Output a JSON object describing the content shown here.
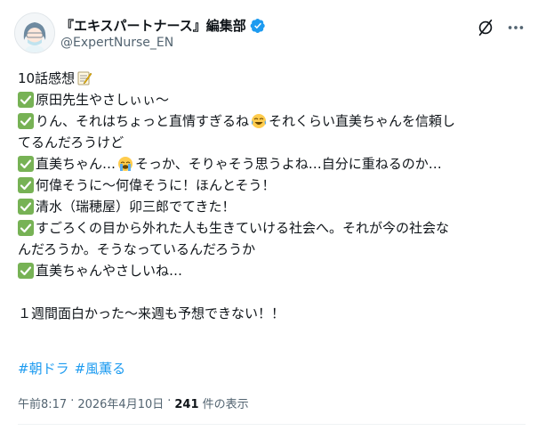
{
  "author": {
    "display_name": "『エキスパートナース』編集部",
    "handle": "@ExpertNurse_EN"
  },
  "tweet": {
    "lines": [
      {
        "text_a": "10話感想",
        "emoji": "memo"
      },
      {
        "check": true,
        "text_a": "原田先生やさしぃぃ～"
      },
      {
        "check": true,
        "text_a": "りん、それはちょっと直情すぎるね",
        "emoji": "joy",
        "text_b": "それくらい直美ちゃんを信頼し"
      },
      {
        "text_a": "てるんだろうけど"
      },
      {
        "check": true,
        "text_a": "直美ちゃん…",
        "emoji": "sob",
        "text_b": "そっか、そりゃそう思うよね…自分に重ねるのか…"
      },
      {
        "check": true,
        "text_a": "何偉そうに～何偉そうに！ほんとそう！"
      },
      {
        "check": true,
        "text_a": "清水（瑞穂屋）卯三郎でてきた！"
      },
      {
        "check": true,
        "text_a": "すごろくの目から外れた人も生きていける社会へ。それが今の社会な"
      },
      {
        "text_a": "んだろうか。そうなっているんだろうか"
      },
      {
        "check": true,
        "text_a": "直美ちゃんやさしいね…"
      }
    ],
    "closing": "１週間面白かった～来週も予想できない！！",
    "hashtags": [
      "#朝ドラ",
      "#風薫る"
    ]
  },
  "meta": {
    "time": "午前8:17",
    "separator": "·",
    "date": "2026年4月10日",
    "views_count": "241",
    "views_label": "件の表示"
  },
  "colors": {
    "check_green": "#77b255",
    "link_blue": "#1d9bf0",
    "verified_blue": "#1d9bf0",
    "muted_gray": "#536471"
  }
}
